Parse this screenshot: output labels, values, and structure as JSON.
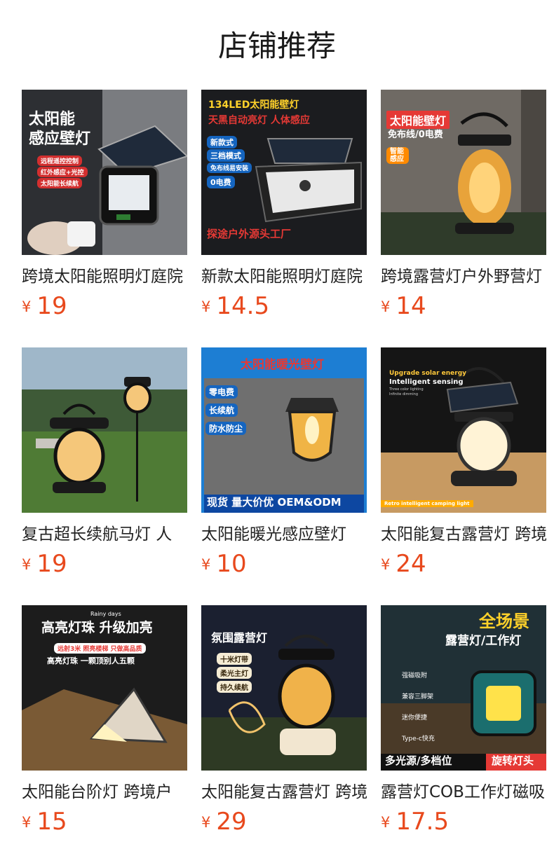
{
  "header": {
    "title": "店铺推荐"
  },
  "colors": {
    "price": "#e8491d",
    "title": "#1a1a1a"
  },
  "currency": "¥",
  "products": [
    {
      "title": "跨境太阳能照明灯庭院",
      "price": "19",
      "image_icon": "solar-wall-light-icon",
      "image_text": [
        "太阳能",
        "感应壁灯",
        "远程遥控控制",
        "红外感应+光控",
        "太阳能长续航"
      ]
    },
    {
      "title": "新款太阳能照明灯庭院",
      "price": "14.5",
      "image_icon": "solar-wall-light-icon",
      "image_text": [
        "134LED太阳能壁灯",
        "天黑自动亮灯 人体感应",
        "新款式",
        "三档模式",
        "免布线易安装",
        "0电费",
        "探途户外源头工厂"
      ]
    },
    {
      "title": "跨境露营灯户外野营灯",
      "price": "14",
      "image_icon": "camping-lantern-icon",
      "image_text": [
        "太阳能壁灯",
        "免布线/0电费",
        "智能感应"
      ]
    },
    {
      "title": "复古超长续航马灯 人",
      "price": "19",
      "image_icon": "garden-lantern-icon",
      "image_text": []
    },
    {
      "title": "太阳能暖光感应壁灯",
      "price": "10",
      "image_icon": "warm-wall-lamp-icon",
      "image_text": [
        "太阳能暖光壁灯",
        "零电费",
        "长续航",
        "防水防尘",
        "现货 量大价优 OEM&ODM"
      ]
    },
    {
      "title": "太阳能复古露营灯 跨境",
      "price": "24",
      "image_icon": "camping-lantern-icon",
      "image_text": [
        "Upgrade solar energy",
        "Intelligent sensing",
        "Three color lighting",
        "Infinite dimming",
        "Retro intelligent camping light"
      ]
    },
    {
      "title": "太阳能台阶灯 跨境户",
      "price": "15",
      "image_icon": "step-light-icon",
      "image_text": [
        "Rainy days",
        "高亮灯珠 升级加亮",
        "远射3米 照亮楼梯 只做高品质",
        "高亮灯珠 一颗顶别人五颗"
      ]
    },
    {
      "title": "太阳能复古露营灯 跨境",
      "price": "29",
      "image_icon": "camping-lantern-icon",
      "image_text": [
        "氛围露营灯",
        "十米灯带",
        "柔光主灯",
        "持久续航"
      ]
    },
    {
      "title": "露营灯COB工作灯磁吸",
      "price": "17.5",
      "image_icon": "work-light-icon",
      "image_text": [
        "全场景",
        "露营灯/工作灯",
        "强磁吸附",
        "兼容三脚架",
        "迷你便捷",
        "Type-c快充",
        "多光源/多档位",
        "旋转灯头"
      ]
    }
  ]
}
